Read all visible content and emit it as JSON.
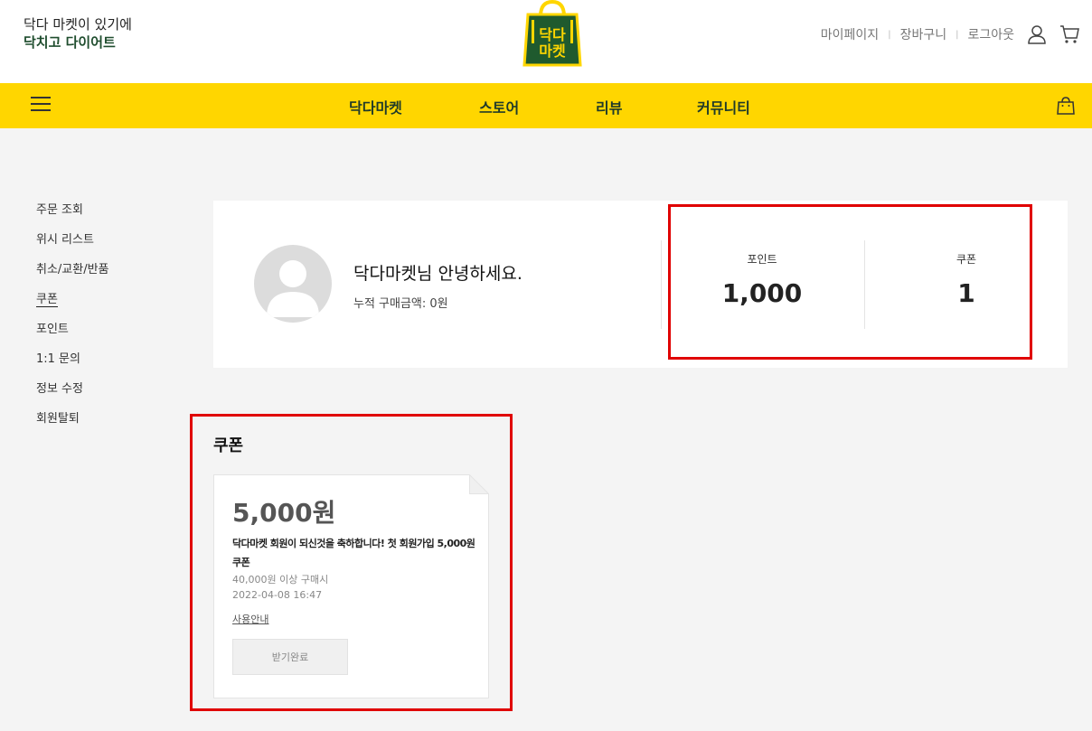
{
  "header": {
    "slogan_line1": "닥다 마켓이 있기에",
    "slogan_line2": "닥치고 다이어트",
    "logo_text_top": "닥다",
    "logo_text_bottom": "마켓",
    "links": [
      "마이페이지",
      "장바구니",
      "로그아웃"
    ],
    "icons": [
      "user-icon",
      "cart-icon"
    ],
    "brand_color": "#1f5a2e",
    "accent_color": "#ffd600"
  },
  "nav": {
    "items": [
      "닥다마켓",
      "스토어",
      "리뷰",
      "커뮤니티"
    ],
    "icons": [
      "hamburger-icon",
      "shopping-bag-icon"
    ]
  },
  "sidebar": {
    "items": [
      "주문 조회",
      "위시 리스트",
      "취소/교환/반품",
      "쿠폰",
      "포인트",
      "1:1 문의",
      "정보 수정",
      "회원탈퇴"
    ],
    "active": "쿠폰"
  },
  "profile": {
    "greeting": "닥다마켓님 안녕하세요.",
    "total_purchase": "누적 구매금액: 0원",
    "point_label": "포인트",
    "point_value": "1,000",
    "coupon_label": "쿠폰",
    "coupon_value": "1"
  },
  "coupons": {
    "title": "쿠폰",
    "items": [
      {
        "amount": "5,000원",
        "description": "닥다마켓 회원이 되신것을 축하합니다! 첫 회원가입 5,000원쿠폰",
        "condition": "40,000원 이상 구매시",
        "date": "2022-04-08 16:47",
        "guide_label": "사용안내",
        "button_label": "받기완료"
      }
    ]
  },
  "highlight_color": "#e00000"
}
